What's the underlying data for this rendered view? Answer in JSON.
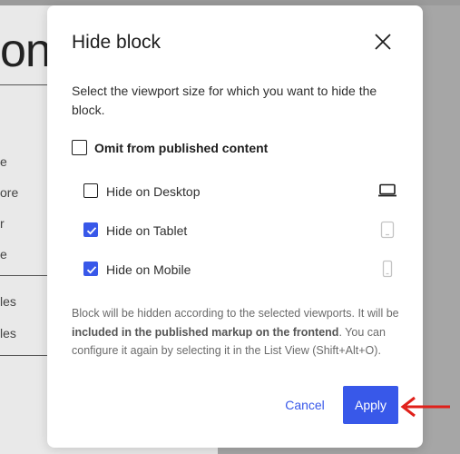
{
  "background": {
    "heading_fragment": "on",
    "items": [
      "e",
      "ore",
      "r",
      "e",
      "les",
      "les"
    ]
  },
  "modal": {
    "title": "Hide block",
    "description": "Select the viewport size for which you want to hide the block.",
    "omit_label": "Omit from published content",
    "omit_checked": false,
    "options": [
      {
        "label": "Hide on Desktop",
        "checked": false,
        "icon": "desktop-icon"
      },
      {
        "label": "Hide on Tablet",
        "checked": true,
        "icon": "tablet-icon"
      },
      {
        "label": "Hide on Mobile",
        "checked": true,
        "icon": "mobile-icon"
      }
    ],
    "note_before": "Block will be hidden according to the selected viewports. It will be ",
    "note_bold": "included in the published markup on the frontend",
    "note_after": ". You can configure it again by selecting it in the List View (Shift+Alt+O).",
    "cancel_label": "Cancel",
    "apply_label": "Apply"
  },
  "colors": {
    "accent": "#3858e9",
    "annotation_arrow": "#e0201a"
  }
}
